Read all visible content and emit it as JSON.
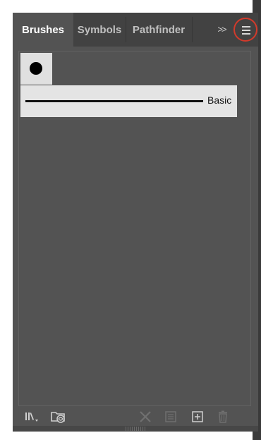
{
  "tabs": [
    {
      "label": "Brushes",
      "active": true
    },
    {
      "label": "Symbols",
      "active": false
    },
    {
      "label": "Pathfinder",
      "active": false
    }
  ],
  "overflow_label": ">>",
  "brushes": {
    "swatch_icon": "round-brush-dot",
    "basic_label": "Basic"
  },
  "footer_icons": [
    "brush-libraries-menu-icon",
    "libraries-panel-icon",
    "remove-brush-stroke-icon",
    "brush-options-icon",
    "new-brush-icon",
    "delete-brush-icon"
  ],
  "colors": {
    "panel_bg": "#535353",
    "tabbar_bg": "#424242",
    "highlight_ring": "#d23a2b"
  }
}
